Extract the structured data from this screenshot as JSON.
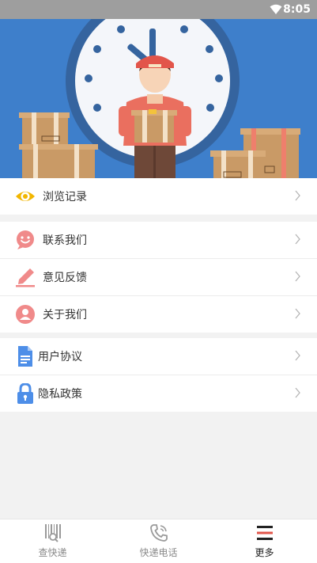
{
  "status_bar": {
    "time": "8:05"
  },
  "menu": {
    "history": {
      "label": "浏览记录"
    },
    "contact": {
      "label": "联系我们"
    },
    "feedback": {
      "label": "意见反馈"
    },
    "about": {
      "label": "关于我们"
    },
    "agreement": {
      "label": "用户协议"
    },
    "privacy": {
      "label": "隐私政策"
    }
  },
  "tabbar": {
    "query": {
      "label": "查快递"
    },
    "phone": {
      "label": "快递电话"
    },
    "more": {
      "label": "更多"
    }
  },
  "colors": {
    "banner_bg": "#3e7fcb",
    "eye_icon": "#f2b600",
    "pink_icon": "#f08a8a",
    "blue_icon": "#4d8ee8",
    "active_tab": "#222222"
  }
}
